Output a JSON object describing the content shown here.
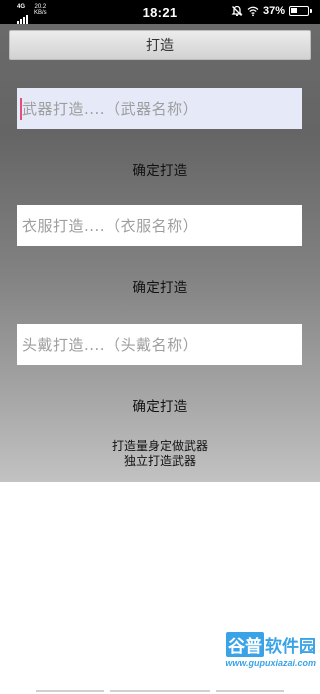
{
  "status_bar": {
    "network": "4G",
    "speed_value": "20.2",
    "speed_unit": "KB/s",
    "time": "18:21",
    "battery": "37%",
    "battery_level": 0.37,
    "icons": [
      "signal-icon",
      "silent-bell-icon",
      "wifi-icon",
      "battery-icon"
    ]
  },
  "app": {
    "title_button": "打造",
    "weapon": {
      "placeholder": "武器打造....（武器名称）",
      "confirm": "确定打造"
    },
    "clothes": {
      "placeholder": "衣服打造....（衣服名称）",
      "confirm": "确定打造"
    },
    "helmet": {
      "placeholder": "头戴打造....（头戴名称）",
      "confirm": "确定打造"
    },
    "note_line1": "打造量身定做武器",
    "note_line2": "独立打造武器"
  },
  "watermark": {
    "logo_box": "谷普",
    "logo_text": "软件园",
    "url": "www.gupuxiazai.com"
  },
  "colors": {
    "accent": "#3aa3e8",
    "focused_field": "#e6e9f7",
    "cursor": "#e0507a"
  }
}
